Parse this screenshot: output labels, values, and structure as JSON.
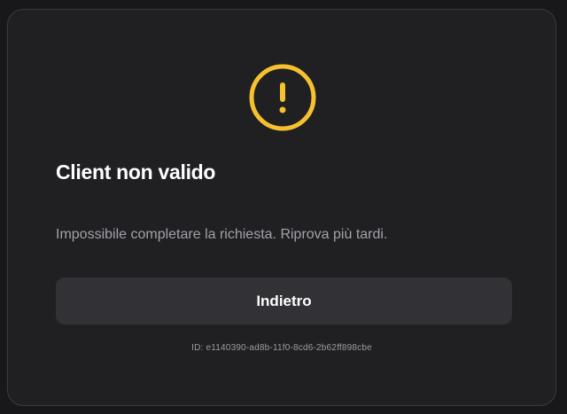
{
  "dialog": {
    "icon": "warning-circle-icon",
    "accent_color": "#f5c12e",
    "title": "Client non valido",
    "message": "Impossibile completare la richiesta. Riprova più tardi.",
    "back_button_label": "Indietro",
    "request_id": "ID: e1140390-ad8b-11f0-8cd6-2b62ff898cbe"
  }
}
